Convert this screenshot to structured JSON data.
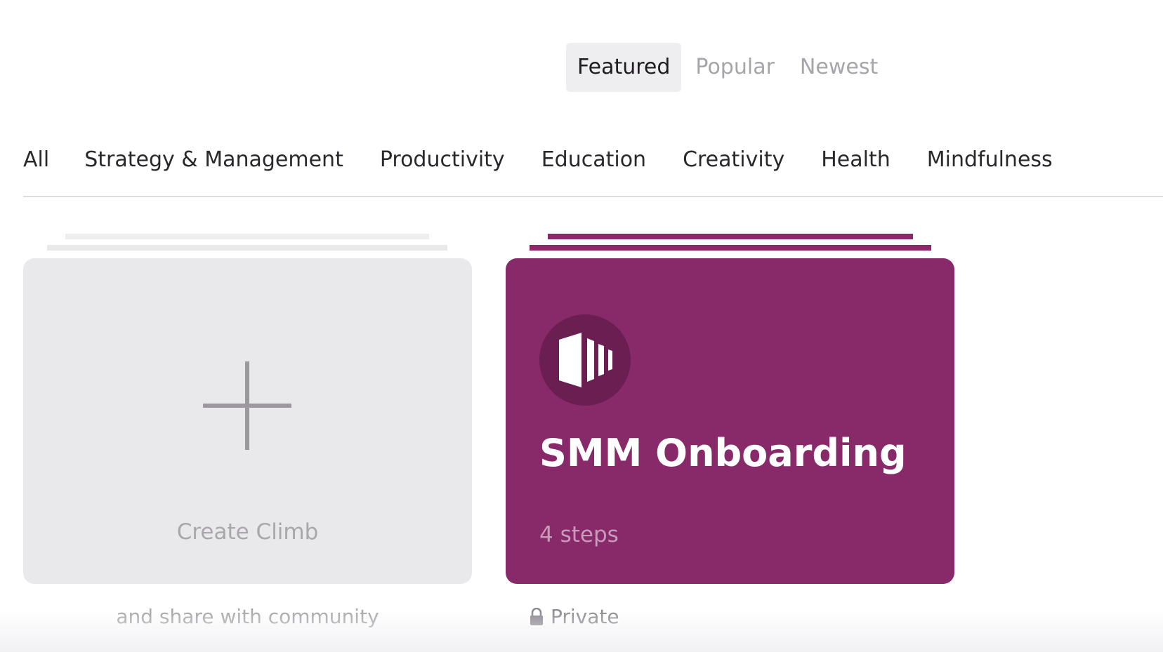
{
  "sort_tabs": [
    {
      "label": "Featured",
      "active": true
    },
    {
      "label": "Popular",
      "active": false
    },
    {
      "label": "Newest",
      "active": false
    }
  ],
  "categories": [
    "All",
    "Strategy & Management",
    "Productivity",
    "Education",
    "Creativity",
    "Health",
    "Mindfulness"
  ],
  "create_card": {
    "label": "Create Climb",
    "caption": "and share with community",
    "icon": "plus-icon"
  },
  "climb_card": {
    "title": "SMM Onboarding",
    "steps": "4 steps",
    "visibility": "Private",
    "icon": "lock-icon",
    "color": "#88296a"
  }
}
